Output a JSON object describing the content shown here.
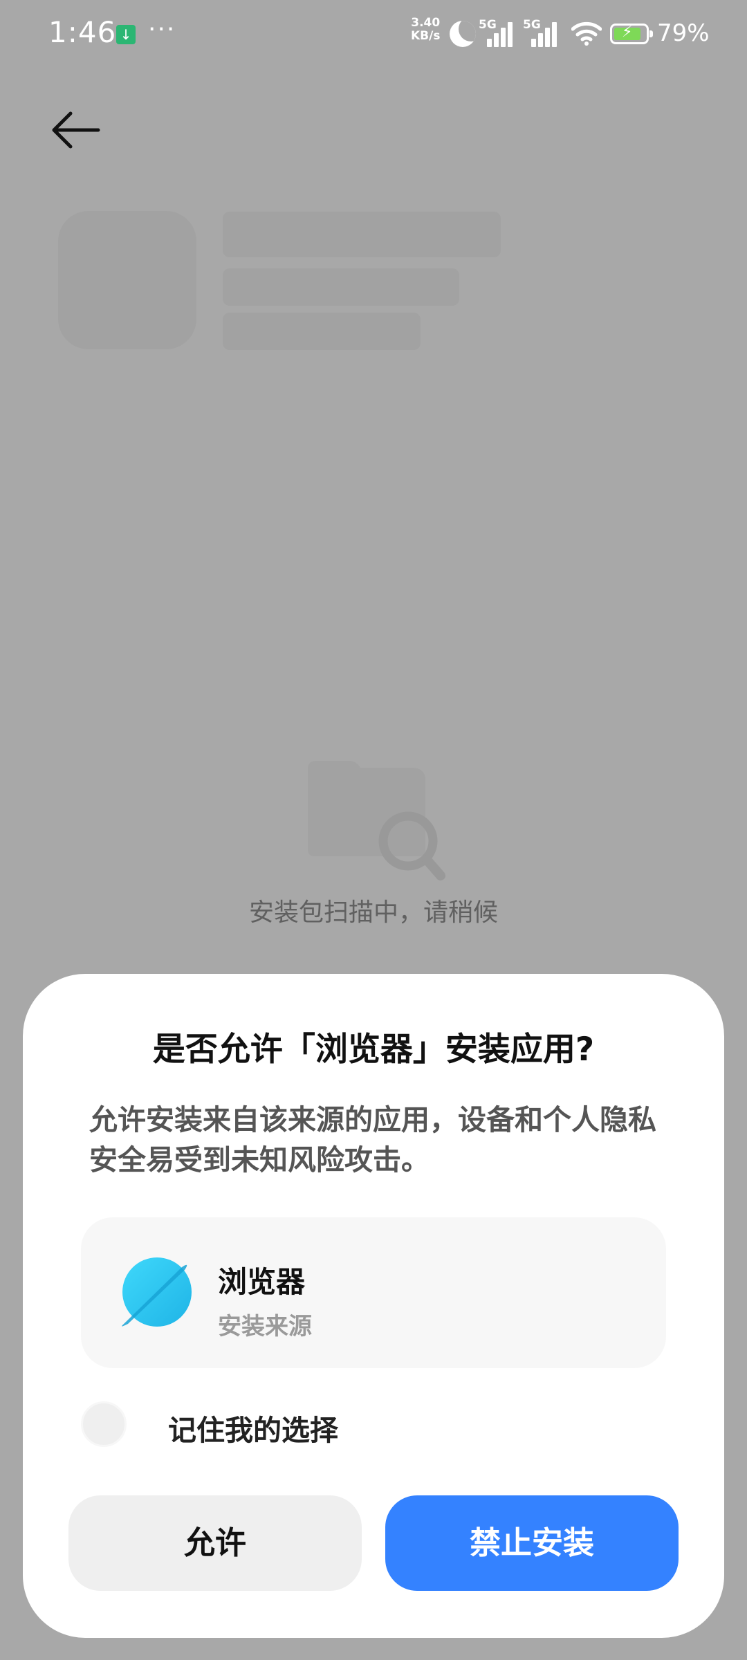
{
  "status_bar": {
    "time": "1:46",
    "net_speed_value": "3.40",
    "net_speed_unit": "KB/s",
    "sim1_label": "5G",
    "sim2_label": "5G",
    "battery_percent": "79%"
  },
  "scan": {
    "text": "安装包扫描中，请稍候"
  },
  "dialog": {
    "title": "是否允许「浏览器」安装应用?",
    "message": "允许安装来自该来源的应用，设备和个人隐私安全易受到未知风险攻击。",
    "app_name": "浏览器",
    "app_subtitle": "安装来源",
    "remember_label": "记住我的选择",
    "remember_checked": false,
    "allow_label": "允许",
    "deny_label": "禁止安装"
  },
  "colors": {
    "overlay_background": "#a8a8a8",
    "primary_button": "#3482ff",
    "secondary_button": "#efefef",
    "app_icon": "#27c3ee"
  }
}
